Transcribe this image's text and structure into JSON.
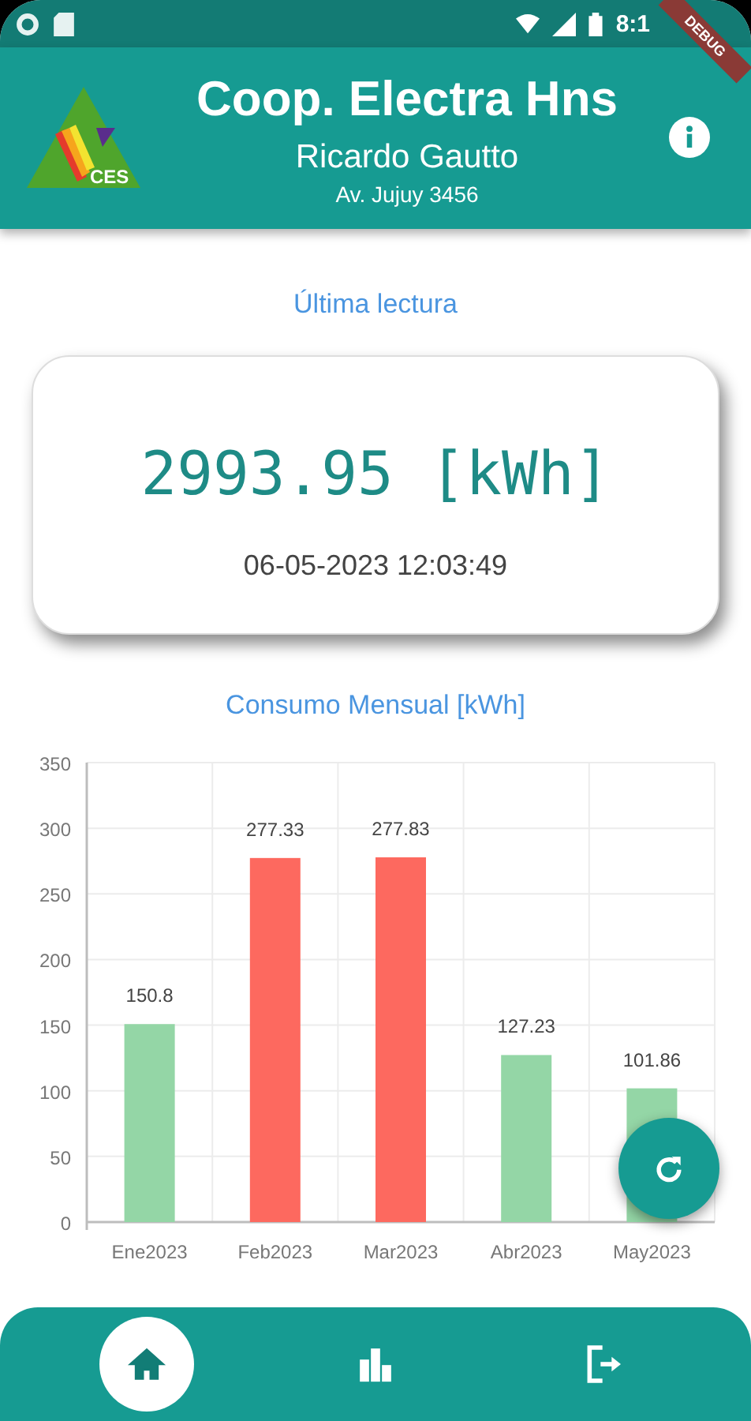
{
  "status_bar": {
    "time": "8:1",
    "debug_banner": "DEBUG"
  },
  "header": {
    "title": "Coop. Electra Hns",
    "user": "Ricardo Gautto",
    "address": "Av. Jujuy 3456",
    "logo_text": "CES"
  },
  "last_reading": {
    "heading": "Última lectura",
    "value": "2993.95 [kWh]",
    "timestamp": "06-05-2023 12:03:49"
  },
  "monthly": {
    "heading": "Consumo Mensual [kWh]",
    "chart_data": {
      "type": "bar",
      "categories": [
        "Ene2023",
        "Feb2023",
        "Mar2023",
        "Abr2023",
        "May2023"
      ],
      "series": [
        {
          "color": "#94d6a6",
          "values": [
            150.8,
            null,
            null,
            127.23,
            101.86
          ]
        },
        {
          "color": "#fd695f",
          "values": [
            null,
            277.33,
            277.83,
            null,
            null
          ]
        }
      ],
      "ylim": [
        0,
        350
      ],
      "yticks": [
        0,
        50,
        100,
        150,
        200,
        250,
        300,
        350
      ],
      "grid": true,
      "data_labels": true
    }
  },
  "nav": [
    {
      "kind": "home",
      "selected": true
    },
    {
      "kind": "chart",
      "selected": false
    },
    {
      "kind": "logout",
      "selected": false
    }
  ]
}
